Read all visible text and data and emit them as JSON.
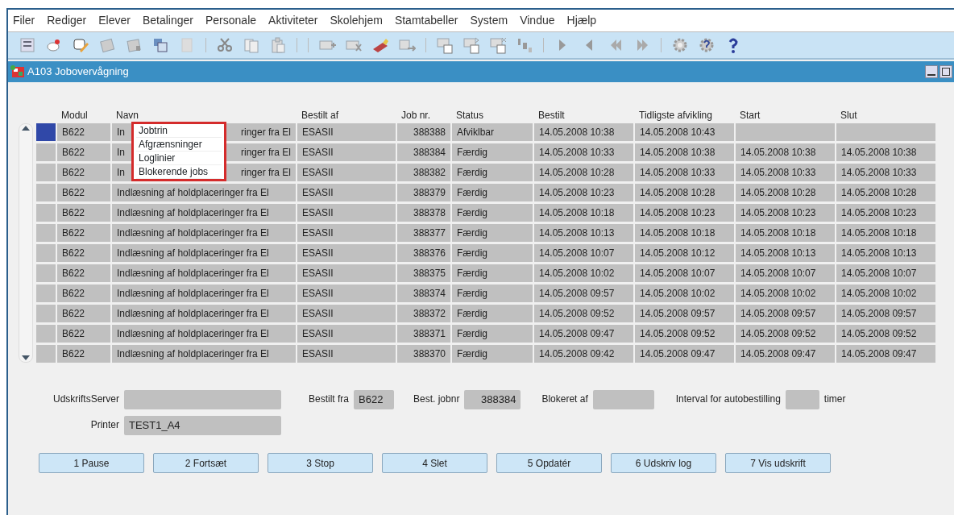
{
  "menu": [
    {
      "label": "Filer"
    },
    {
      "label": "Rediger"
    },
    {
      "label": "Elever"
    },
    {
      "label": "Betalinger"
    },
    {
      "label": "Personale"
    },
    {
      "label": "Aktiviteter"
    },
    {
      "label": "Skolehjem"
    },
    {
      "label": "Stamtabeller"
    },
    {
      "label": "System"
    },
    {
      "label": "Vindue"
    },
    {
      "label": "Hjælp"
    }
  ],
  "window": {
    "title": "A103 Jobovervågning"
  },
  "table": {
    "columns": [
      "Modul",
      "Navn",
      "Bestilt af",
      "Job nr.",
      "Status",
      "Bestilt",
      "Tidligste afvikling",
      "Start",
      "Slut"
    ],
    "rows": [
      {
        "selected": true,
        "cells": [
          "B622",
          {
            "start": "In",
            "end": "ringer fra El"
          },
          "ESASII",
          "388388",
          "Afviklbar",
          "14.05.2008 10:38",
          "14.05.2008 10:43",
          null,
          null
        ]
      },
      {
        "selected": false,
        "cells": [
          "B622",
          {
            "start": "In",
            "end": "ringer fra El"
          },
          "ESASII",
          "388384",
          "Færdig",
          "14.05.2008 10:33",
          "14.05.2008 10:38",
          "14.05.2008 10:38",
          "14.05.2008 10:38"
        ]
      },
      {
        "selected": false,
        "cells": [
          "B622",
          {
            "start": "In",
            "end": "ringer fra El"
          },
          "ESASII",
          "388382",
          "Færdig",
          "14.05.2008 10:28",
          "14.05.2008 10:33",
          "14.05.2008 10:33",
          "14.05.2008 10:33"
        ]
      },
      {
        "selected": false,
        "cells": [
          "B622",
          "Indlæsning af holdplaceringer fra El",
          "ESASII",
          "388379",
          "Færdig",
          "14.05.2008 10:23",
          "14.05.2008 10:28",
          "14.05.2008 10:28",
          "14.05.2008 10:28"
        ]
      },
      {
        "selected": false,
        "cells": [
          "B622",
          "Indlæsning af holdplaceringer fra El",
          "ESASII",
          "388378",
          "Færdig",
          "14.05.2008 10:18",
          "14.05.2008 10:23",
          "14.05.2008 10:23",
          "14.05.2008 10:23"
        ]
      },
      {
        "selected": false,
        "cells": [
          "B622",
          "Indlæsning af holdplaceringer fra El",
          "ESASII",
          "388377",
          "Færdig",
          "14.05.2008 10:13",
          "14.05.2008 10:18",
          "14.05.2008 10:18",
          "14.05.2008 10:18"
        ]
      },
      {
        "selected": false,
        "cells": [
          "B622",
          "Indlæsning af holdplaceringer fra El",
          "ESASII",
          "388376",
          "Færdig",
          "14.05.2008 10:07",
          "14.05.2008 10:12",
          "14.05.2008 10:13",
          "14.05.2008 10:13"
        ]
      },
      {
        "selected": false,
        "cells": [
          "B622",
          "Indlæsning af holdplaceringer fra El",
          "ESASII",
          "388375",
          "Færdig",
          "14.05.2008 10:02",
          "14.05.2008 10:07",
          "14.05.2008 10:07",
          "14.05.2008 10:07"
        ]
      },
      {
        "selected": false,
        "cells": [
          "B622",
          "Indlæsning af holdplaceringer fra El",
          "ESASII",
          "388374",
          "Færdig",
          "14.05.2008 09:57",
          "14.05.2008 10:02",
          "14.05.2008 10:02",
          "14.05.2008 10:02"
        ]
      },
      {
        "selected": false,
        "cells": [
          "B622",
          "Indlæsning af holdplaceringer fra El",
          "ESASII",
          "388372",
          "Færdig",
          "14.05.2008 09:52",
          "14.05.2008 09:57",
          "14.05.2008 09:57",
          "14.05.2008 09:57"
        ]
      },
      {
        "selected": false,
        "cells": [
          "B622",
          "Indlæsning af holdplaceringer fra El",
          "ESASII",
          "388371",
          "Færdig",
          "14.05.2008 09:47",
          "14.05.2008 09:52",
          "14.05.2008 09:52",
          "14.05.2008 09:52"
        ]
      },
      {
        "selected": false,
        "cells": [
          "B622",
          "Indlæsning af holdplaceringer fra El",
          "ESASII",
          "388370",
          "Færdig",
          "14.05.2008 09:42",
          "14.05.2008 09:47",
          "14.05.2008 09:47",
          "14.05.2008 09:47"
        ]
      }
    ]
  },
  "context_menu": {
    "items": [
      "Jobtrin",
      "Afgrænsninger",
      "Loglinier",
      "Blokerende jobs"
    ]
  },
  "form": {
    "udskriftsserver": {
      "label": "UdskriftsServer"
    },
    "printer": {
      "label": "Printer",
      "value": "TEST1_A4"
    },
    "bestilt_fra": {
      "label": "Bestilt fra",
      "value": "B622"
    },
    "best_jobnr": {
      "label": "Best. jobnr",
      "value": "388384"
    },
    "blokeret_af": {
      "label": "Blokeret af"
    },
    "interval": {
      "label": "Interval for autobestilling",
      "unit": "timer"
    }
  },
  "buttons": [
    "1 Pause",
    "2 Fortsæt",
    "3 Stop",
    "4 Slet",
    "5 Opdatér",
    "6 Udskriv log",
    "7 Vis udskrift"
  ]
}
